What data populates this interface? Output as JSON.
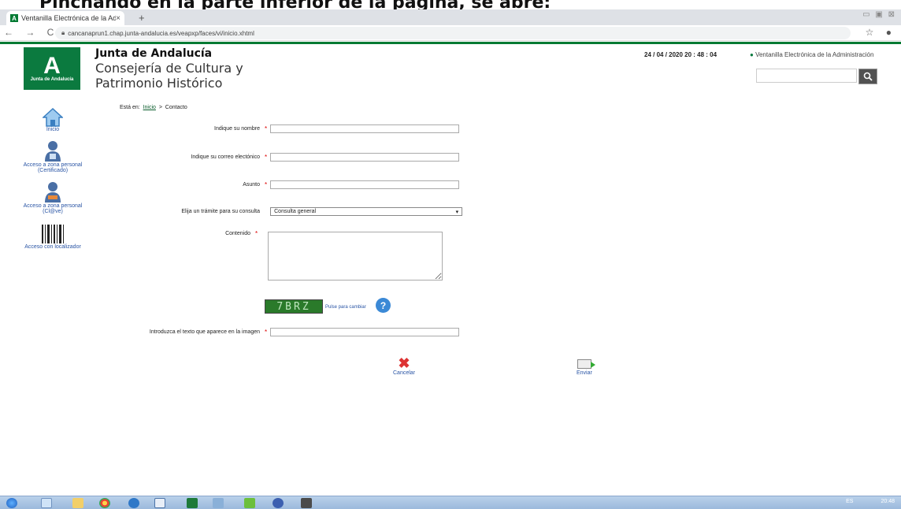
{
  "caption": "Pinchando en la parte inferior de la página, se abre:",
  "browser": {
    "tab_title": "Ventanilla Electrónica de la Admi",
    "tab_close": "×",
    "new_tab": "+",
    "window_controls": "▭ ▣ ⊠",
    "nav_icons": "← → C",
    "url": "cancanaprun1.chap.junta-andalucia.es/veapxp/faces/vi/inicio.xhtml",
    "right_icons": "☆ ●"
  },
  "header": {
    "logo_letter": "A",
    "logo_text": "Junta de Andalucía",
    "org_name": "Junta de Andalucía",
    "dept_line1": "Consejería de Cultura y",
    "dept_line2": "Patrimonio Histórico",
    "datetime": "24 / 04 / 2020   20 : 48 : 04",
    "ventanilla": "Ventanilla Electrónica de la Administración",
    "search_placeholder": ""
  },
  "sidebar": {
    "items": [
      {
        "label": "Inicio"
      },
      {
        "label": "Acceso a zona personal (Certificado)"
      },
      {
        "label": "Acceso a zona personal (Cl@ve)"
      },
      {
        "label": "Acceso con localizador"
      }
    ]
  },
  "breadcrumb": {
    "prefix": "Está en:",
    "home": "Inicio",
    "sep": ">",
    "current": "Contacto"
  },
  "form": {
    "required_mark": "*",
    "name_label": "Indique su nombre",
    "name_value": "",
    "email_label": "Indique su correo electónico",
    "email_value": "",
    "subject_label": "Asunto",
    "subject_value": "",
    "tramite_label": "Elija un trámite para su consulta",
    "tramite_value": "Consulta general",
    "content_label": "Contenido",
    "content_value": "",
    "captcha_text": "7BRZ",
    "captcha_change": "Pulse para cambiar",
    "captcha_help": "?",
    "captcha_label": "Introduzca el texto que aparece en la imagen",
    "captcha_value": "",
    "cancel_label": "Cancelar",
    "send_label": "Enviar"
  },
  "taskbar": {
    "lang": "ES",
    "time": "20:48"
  }
}
